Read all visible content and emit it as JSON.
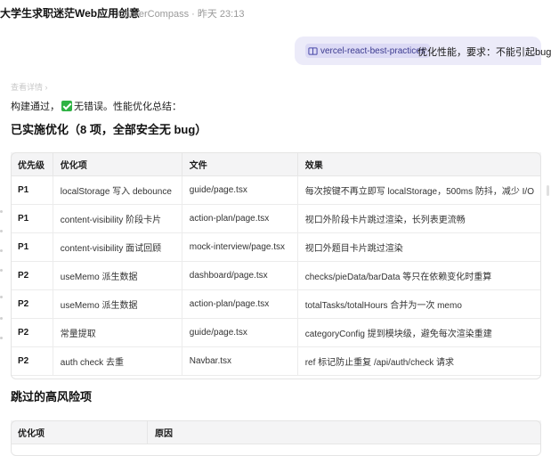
{
  "header": {
    "title": "大学生求职迷茫Web应用创意",
    "meta": "CareerCompass · 昨天 23:13"
  },
  "user_message": {
    "skill_chip": "vercel-react-best-practices",
    "text": "优化性能，要求：不能引起bug"
  },
  "assistant": {
    "collapsed_label": "查看详情 ›",
    "summary_prefix": "构建通过，",
    "summary_suffix": "无错误。性能优化总结：",
    "heading_applied": "已实施优化（8 项，全部安全无 bug）",
    "heading_skipped": "跳过的高风险项"
  },
  "applied_table": {
    "columns": [
      "优先级",
      "优化项",
      "文件",
      "效果"
    ],
    "rows": [
      [
        "P1",
        "localStorage 写入 debounce",
        "guide/page.tsx",
        "每次按键不再立即写 localStorage，500ms 防抖，减少 I/O"
      ],
      [
        "P1",
        "content-visibility 阶段卡片",
        "action-plan/page.tsx",
        "视口外阶段卡片跳过渲染，长列表更流畅"
      ],
      [
        "P1",
        "content-visibility 面试回顾",
        "mock-interview/page.tsx",
        "视口外题目卡片跳过渲染"
      ],
      [
        "P2",
        "useMemo 派生数据",
        "dashboard/page.tsx",
        "checks/pieData/barData 等只在依赖变化时重算"
      ],
      [
        "P2",
        "useMemo 派生数据",
        "action-plan/page.tsx",
        "totalTasks/totalHours 合并为一次 memo"
      ],
      [
        "P2",
        "常量提取",
        "guide/page.tsx",
        "categoryConfig 提到模块级，避免每次渲染重建"
      ],
      [
        "P2",
        "auth check 去重",
        "Navbar.tsx",
        "ref 标记防止重复 /api/auth/check 请求"
      ]
    ]
  },
  "skipped_table": {
    "columns": [
      "优化项",
      "原因"
    ]
  },
  "colors": {
    "bubble_bg": "#ecebf9",
    "chip_bg": "#dcdaf5",
    "check_green": "#2fb344",
    "table_header_bg": "#f4f4f5"
  }
}
